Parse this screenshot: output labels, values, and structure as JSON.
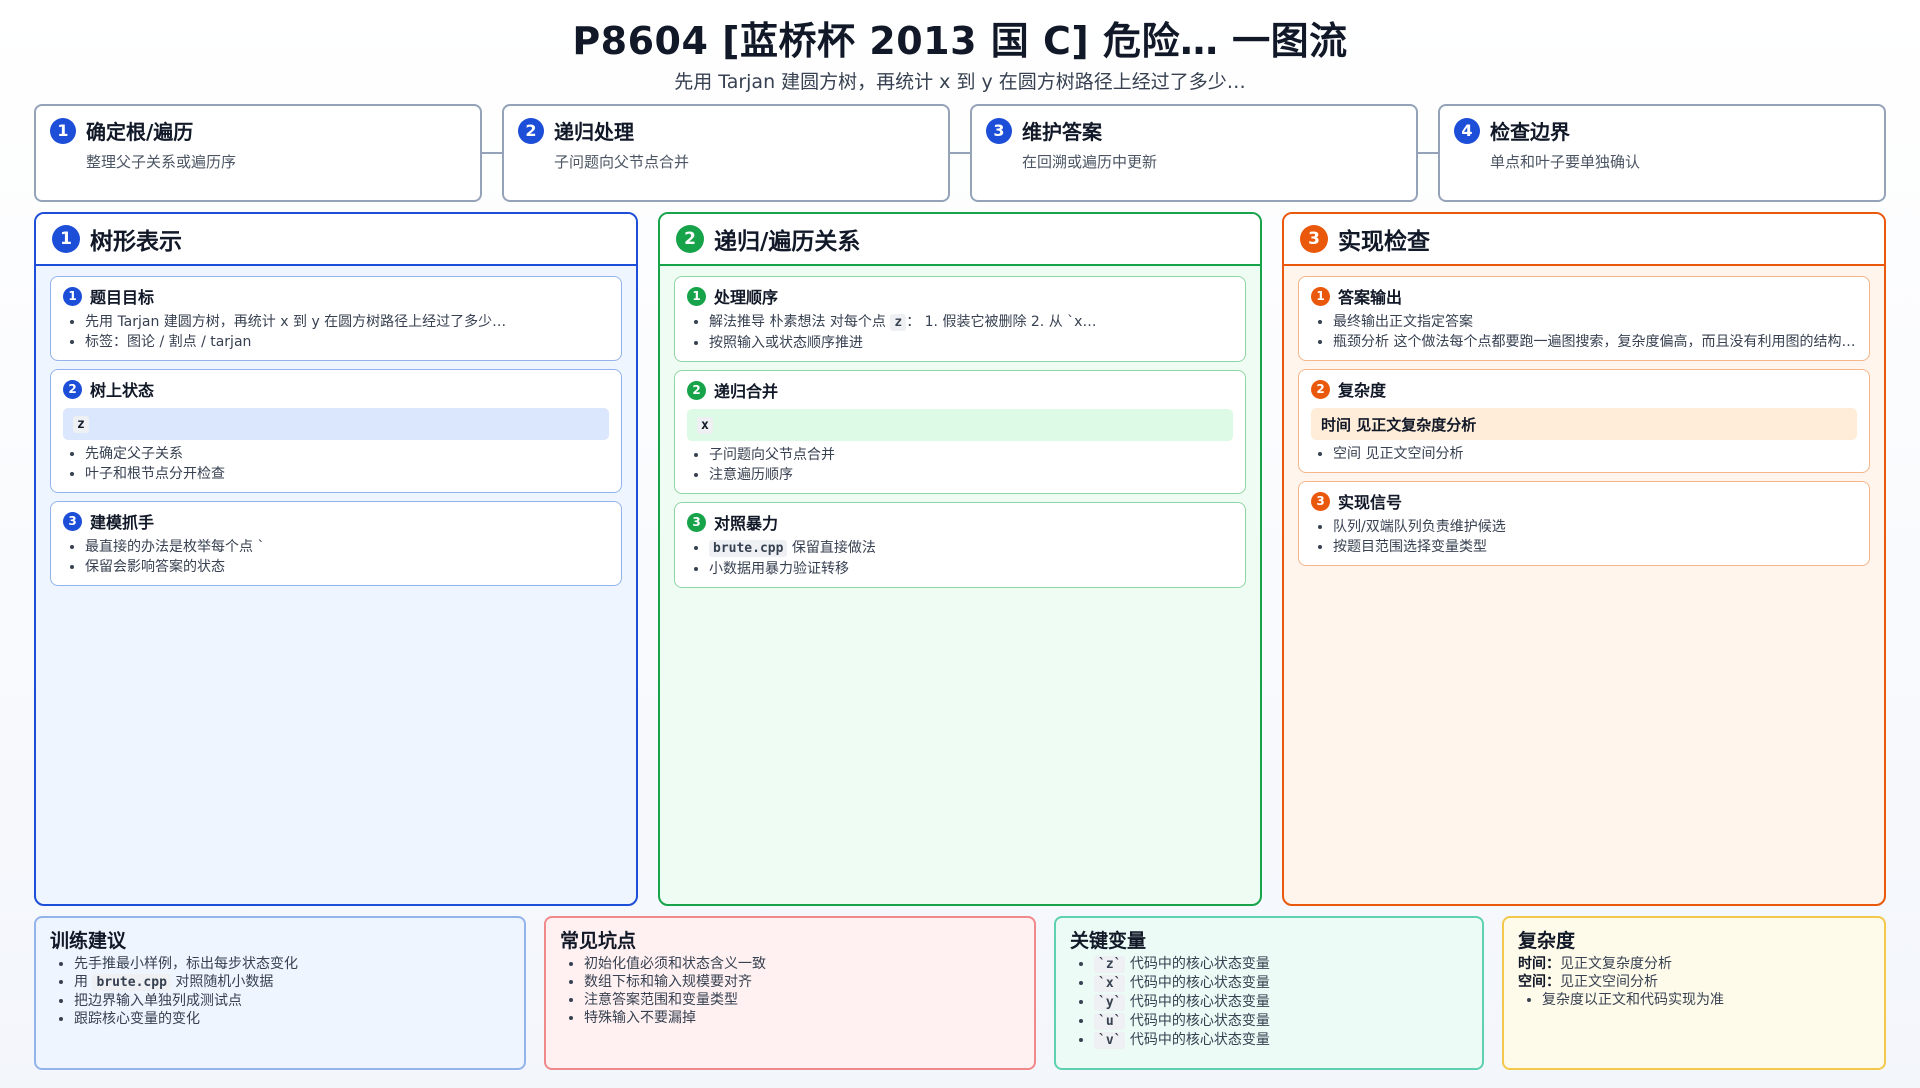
{
  "header": {
    "title": "P8604 [蓝桥杯 2013 国 C] 危险… 一图流",
    "subtitle": "先用 Tarjan 建圆方树，再统计 x 到 y 在圆方树路径上经过了多少…"
  },
  "steps": [
    {
      "num": "1",
      "title": "确定根/遍历",
      "desc": "整理父子关系或遍历序"
    },
    {
      "num": "2",
      "title": "递归处理",
      "desc": "子问题向父节点合并"
    },
    {
      "num": "3",
      "title": "维护答案",
      "desc": "在回溯或遍历中更新"
    },
    {
      "num": "4",
      "title": "检查边界",
      "desc": "单点和叶子要单独确认"
    }
  ],
  "columns": [
    {
      "num": "1",
      "title": "树形表示",
      "color": "#1d4ed8",
      "bg": "#eff5ff",
      "cards": [
        {
          "num": "1",
          "title": "题目目标",
          "items": [
            "先用 Tarjan 建圆方树，再统计 x 到 y 在圆方树路径上经过了多少…",
            "标签：图论 / 割点 / tarjan"
          ]
        },
        {
          "num": "2",
          "title": "树上状态",
          "code": "z",
          "items": [
            "先确定父子关系",
            "叶子和根节点分开检查"
          ]
        },
        {
          "num": "3",
          "title": "建模抓手",
          "items": [
            "最直接的办法是枚举每个点 `",
            "保留会影响答案的状态"
          ]
        }
      ]
    },
    {
      "num": "2",
      "title": "递归/遍历关系",
      "color": "#16a34a",
      "bg": "#effcf3",
      "cards": [
        {
          "num": "1",
          "title": "处理顺序",
          "item0_pre": "解法推导 朴素想法 对每个点 ",
          "item0_code": "z",
          "item0_post": "： 1. 假装它被删除 2. 从 `x…",
          "items": [
            "按照输入或状态顺序推进"
          ]
        },
        {
          "num": "2",
          "title": "递归合并",
          "code": "x",
          "items": [
            "子问题向父节点合并",
            "注意遍历顺序"
          ]
        },
        {
          "num": "3",
          "title": "对照暴力",
          "item0_code": "brute.cpp",
          "item0_post": " 保留直接做法",
          "items": [
            "小数据用暴力验证转移"
          ]
        }
      ]
    },
    {
      "num": "3",
      "title": "实现检查",
      "color": "#ea580c",
      "bg": "#fff5ec",
      "cards": [
        {
          "num": "1",
          "title": "答案输出",
          "items": [
            "最终输出正文指定答案",
            "瓶颈分析 这个做法每个点都要跑一遍图搜索，复杂度偏高，而且没有利用图的结构…"
          ]
        },
        {
          "num": "2",
          "title": "复杂度",
          "highlight": "时间 见正文复杂度分析",
          "items": [
            "空间 见正文空间分析"
          ]
        },
        {
          "num": "3",
          "title": "实现信号",
          "items": [
            "队列/双端队列负责维护候选",
            "按题目范围选择变量类型"
          ]
        }
      ]
    }
  ],
  "panels": {
    "training": {
      "title": "训练建议",
      "item0": "先手推最小样例，标出每步状态变化",
      "item1_pre": "用 ",
      "item1_code": "brute.cpp",
      "item1_post": " 对照随机小数据",
      "item2": "把边界输入单独列成测试点",
      "item3": "跟踪核心变量的变化"
    },
    "pitfalls": {
      "title": "常见坑点",
      "items": [
        "初始化值必须和状态含义一致",
        "数组下标和输入规模要对齐",
        "注意答案范围和变量类型",
        "特殊输入不要漏掉"
      ]
    },
    "variables": {
      "title": "关键变量",
      "items": [
        {
          "code": "`z`",
          "text": " 代码中的核心状态变量"
        },
        {
          "code": "`x`",
          "text": " 代码中的核心状态变量"
        },
        {
          "code": "`y`",
          "text": " 代码中的核心状态变量"
        },
        {
          "code": "`u`",
          "text": " 代码中的核心状态变量"
        },
        {
          "code": "`v`",
          "text": " 代码中的核心状态变量"
        }
      ]
    },
    "complexity": {
      "title": "复杂度",
      "time_label": "时间：",
      "time_value": "见正文复杂度分析",
      "space_label": "空间：",
      "space_value": "见正文空间分析",
      "note": "复杂度以正文和代码实现为准"
    }
  }
}
